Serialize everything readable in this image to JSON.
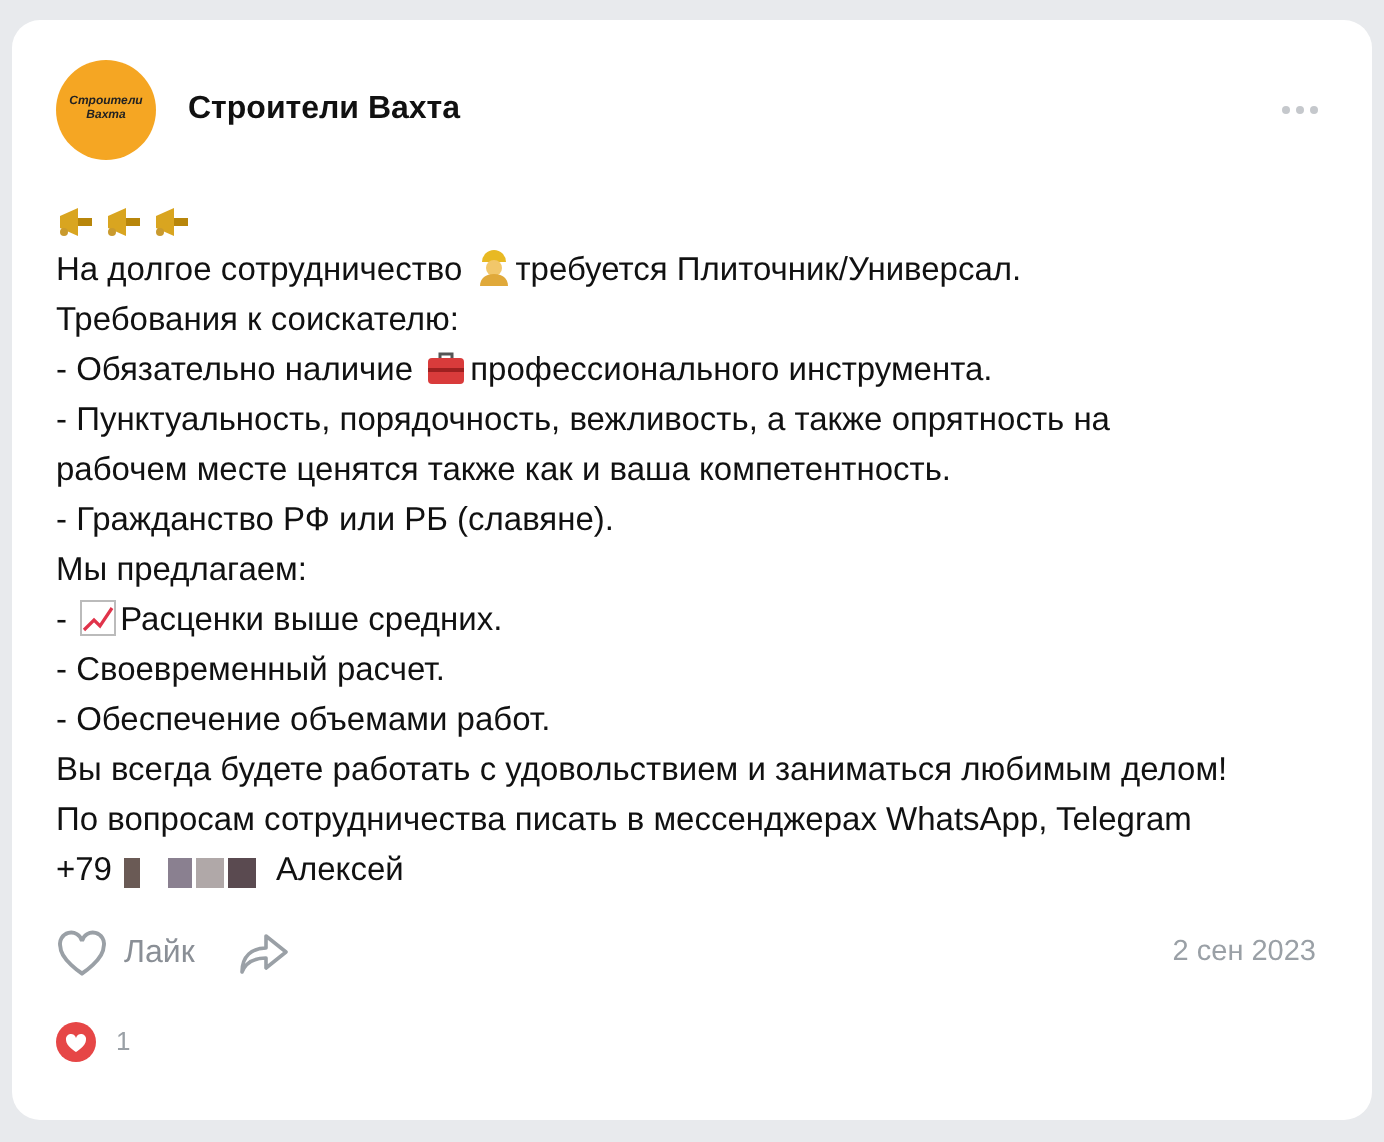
{
  "post": {
    "author": "Строители Вахта",
    "avatar_text": [
      "Строители",
      "Вахта"
    ],
    "lines": [
      {
        "kind": "horns"
      },
      {
        "kind": "worker",
        "parts": [
          "На долгое сотрудничество ",
          "требуется Плиточник/Универсал."
        ]
      },
      {
        "kind": "text",
        "parts": [
          "Требования к соискателю:"
        ]
      },
      {
        "kind": "toolbox",
        "parts": [
          "- Обязательно наличие ",
          "профессионального инструмента."
        ]
      },
      {
        "kind": "text",
        "parts": [
          "- Пунктуальность, порядочность, вежливость, а также опрятность на"
        ]
      },
      {
        "kind": "text",
        "parts": [
          "рабочем месте ценятся также как и ваша компетентность."
        ]
      },
      {
        "kind": "text",
        "parts": [
          "- Гражданство РФ или РБ (славяне)."
        ]
      },
      {
        "kind": "text",
        "parts": [
          "Мы предлагаем:"
        ]
      },
      {
        "kind": "chart",
        "parts": [
          "- ",
          "Расценки выше средних."
        ]
      },
      {
        "kind": "text",
        "parts": [
          "- Своевременный расчет."
        ]
      },
      {
        "kind": "text",
        "parts": [
          "- Обеспечение объемами работ."
        ]
      },
      {
        "kind": "text",
        "parts": [
          "Вы всегда будете работать с удовольствием и заниматься любимым делом!"
        ]
      },
      {
        "kind": "text",
        "parts": [
          "По вопросам сотрудничества писать в мессенджерах WhatsApp, Telegram"
        ]
      },
      {
        "kind": "phone",
        "parts": [
          "+79",
          "Алексей"
        ]
      }
    ],
    "like_label": "Лайк",
    "liked": false,
    "date": "2 сен 2023",
    "reactions_count": "1"
  }
}
